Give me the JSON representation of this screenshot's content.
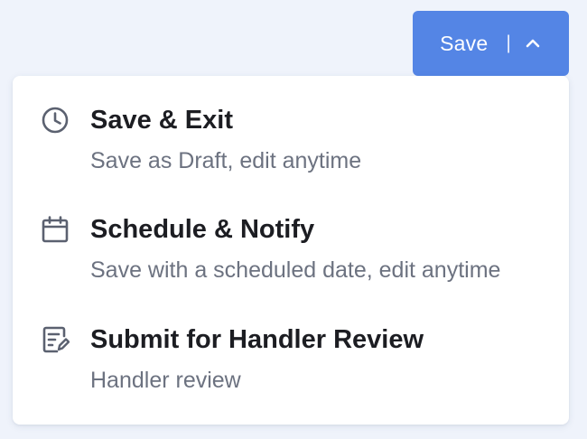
{
  "save_button": {
    "label": "Save",
    "divider": "|",
    "chevron_icon": "chevron-up-icon",
    "background": "#5485e5"
  },
  "menu": {
    "items": [
      {
        "icon": "clock-icon",
        "title": "Save & Exit",
        "description": "Save as Draft, edit anytime"
      },
      {
        "icon": "calendar-icon",
        "title": "Schedule & Notify",
        "description": "Save with a scheduled date, edit anytime"
      },
      {
        "icon": "edit-document-icon",
        "title": "Submit for Handler Review",
        "description": "Handler review"
      }
    ]
  },
  "colors": {
    "page_background": "#eff3fb",
    "title_text": "#1c1d22",
    "description_text": "#6c7280",
    "icon": "#5b6170"
  }
}
